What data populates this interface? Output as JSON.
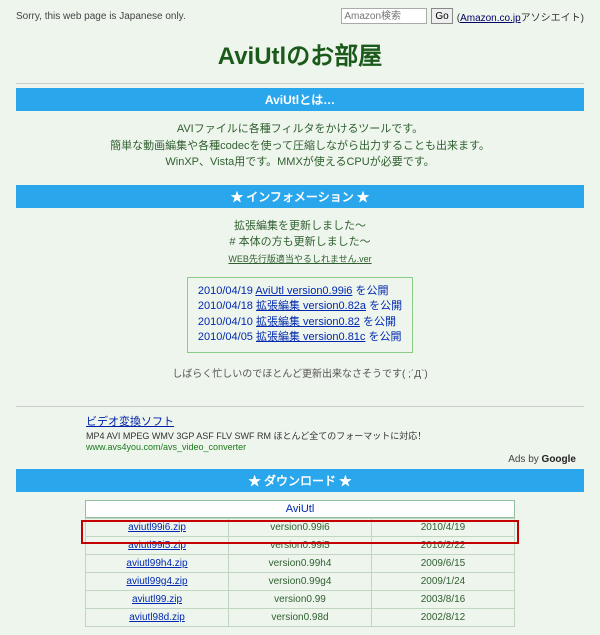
{
  "top": {
    "notice": "Sorry, this web page is Japanese only.",
    "search_placeholder": "Amazon検索",
    "go_label": "Go",
    "amazon_link": "Amazon.co.jp",
    "amazon_suffix": "アソシエイト)"
  },
  "title": "AviUtlのお部屋",
  "sections": {
    "about_header": "AviUtlとは…",
    "about_lines": [
      "AVIファイルに各種フィルタをかけるツールです。",
      "簡単な動画編集や各種codecを使って圧縮しながら出力することも出来ます。",
      "WinXP、Vista用です。MMXが使えるCPUが必要です。"
    ],
    "info_header": "★ インフォメーション ★",
    "info_lines": [
      "拡張編集を更新しました～",
      "# 本体の方も更新しました～"
    ],
    "info_small": "WEB先行版適当やるしれません.ver",
    "news": [
      {
        "date": "2010/04/19",
        "link": "AviUtl version0.99i6",
        "tail": " を公開"
      },
      {
        "date": "2010/04/18",
        "link": "拡張編集 version0.82a",
        "tail": " を公開"
      },
      {
        "date": "2010/04/10",
        "link": "拡張編集 version0.82",
        "tail": " を公開"
      },
      {
        "date": "2010/04/05",
        "link": "拡張編集 version0.81c",
        "tail": " を公開"
      }
    ],
    "busy": "しばらく忙しいのでほとんど更新出来なさそうです( ;´Д`)",
    "download_header": "★ ダウンロード ★",
    "dl_category": "AviUtl"
  },
  "ad": {
    "title": "ビデオ変換ソフト",
    "desc": "MP4 AVI MPEG WMV 3GP ASF FLV SWF RM ほとんど全てのフォーマットに対応！",
    "url": "www.avs4you.com/avs_video_converter",
    "ads_by_prefix": "Ads by ",
    "ads_by_brand": "Google"
  },
  "downloads": [
    {
      "file": "aviutl99i6.zip",
      "version": "version0.99i6",
      "date": "2010/4/19"
    },
    {
      "file": "aviutl99i5.zip",
      "version": "version0.99i5",
      "date": "2010/2/22"
    },
    {
      "file": "aviutl99h4.zip",
      "version": "version0.99h4",
      "date": "2009/6/15"
    },
    {
      "file": "aviutl99g4.zip",
      "version": "version0.99g4",
      "date": "2009/1/24"
    },
    {
      "file": "aviutl99.zip",
      "version": "version0.99",
      "date": "2003/8/16"
    },
    {
      "file": "aviutl98d.zip",
      "version": "version0.98d",
      "date": "2002/8/12"
    }
  ]
}
